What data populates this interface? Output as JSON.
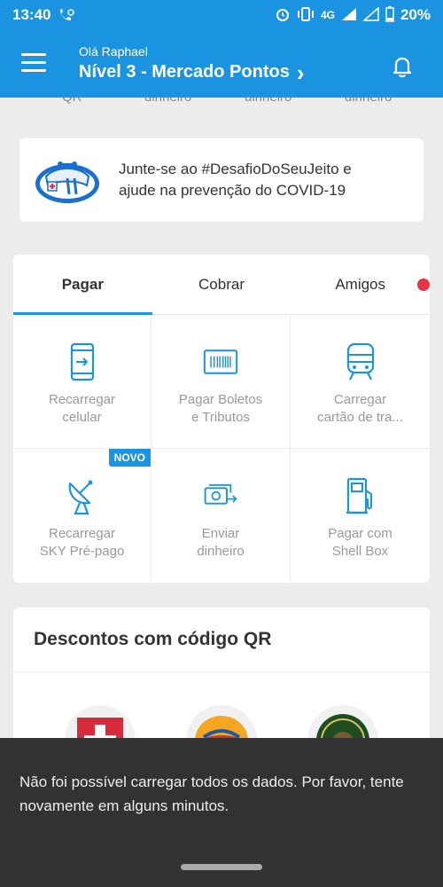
{
  "status_bar": {
    "time": "13:40",
    "network_label": "4G",
    "battery": "20%"
  },
  "header": {
    "greeting": "Olá Raphael",
    "level": "Nível 3 - Mercado Pontos",
    "level_chevron": "›"
  },
  "cutoff_labels": [
    "QR",
    "dinheiro",
    "dinheiro",
    "dinheiro"
  ],
  "covid_card": {
    "text_line1": "Junte-se ao #DesafioDoSeuJeito e",
    "text_line2": "ajude na prevenção do COVID-19"
  },
  "tabs": [
    {
      "label": "Pagar",
      "active": true
    },
    {
      "label": "Cobrar",
      "active": false
    },
    {
      "label": "Amigos",
      "active": false
    }
  ],
  "actions": [
    {
      "label": "Recarregar\ncelular",
      "icon": "phone-recharge-icon"
    },
    {
      "label": "Pagar Boletos\ne Tributos",
      "icon": "barcode-icon"
    },
    {
      "label": "Carregar\ncartão de tra...",
      "icon": "train-icon"
    },
    {
      "label": "Recarregar\nSKY Pré-pago",
      "icon": "satellite-dish-icon",
      "badge": "NOVO"
    },
    {
      "label": "Enviar\ndinheiro",
      "icon": "send-money-icon"
    },
    {
      "label": "Pagar com\nShell Box",
      "icon": "fuel-pump-icon"
    }
  ],
  "qr_section": {
    "title": "Descontos com código QR",
    "logos": [
      "cross-logo",
      "burger-king-logo",
      "nutty-logo"
    ]
  },
  "snackbar": {
    "message": "Não foi possível carregar todos os dados. Por favor, tente novamente em alguns minutos."
  },
  "colors": {
    "primary": "#1a93e0",
    "notification_dot": "#e8334a",
    "snackbar_bg": "#323232"
  }
}
